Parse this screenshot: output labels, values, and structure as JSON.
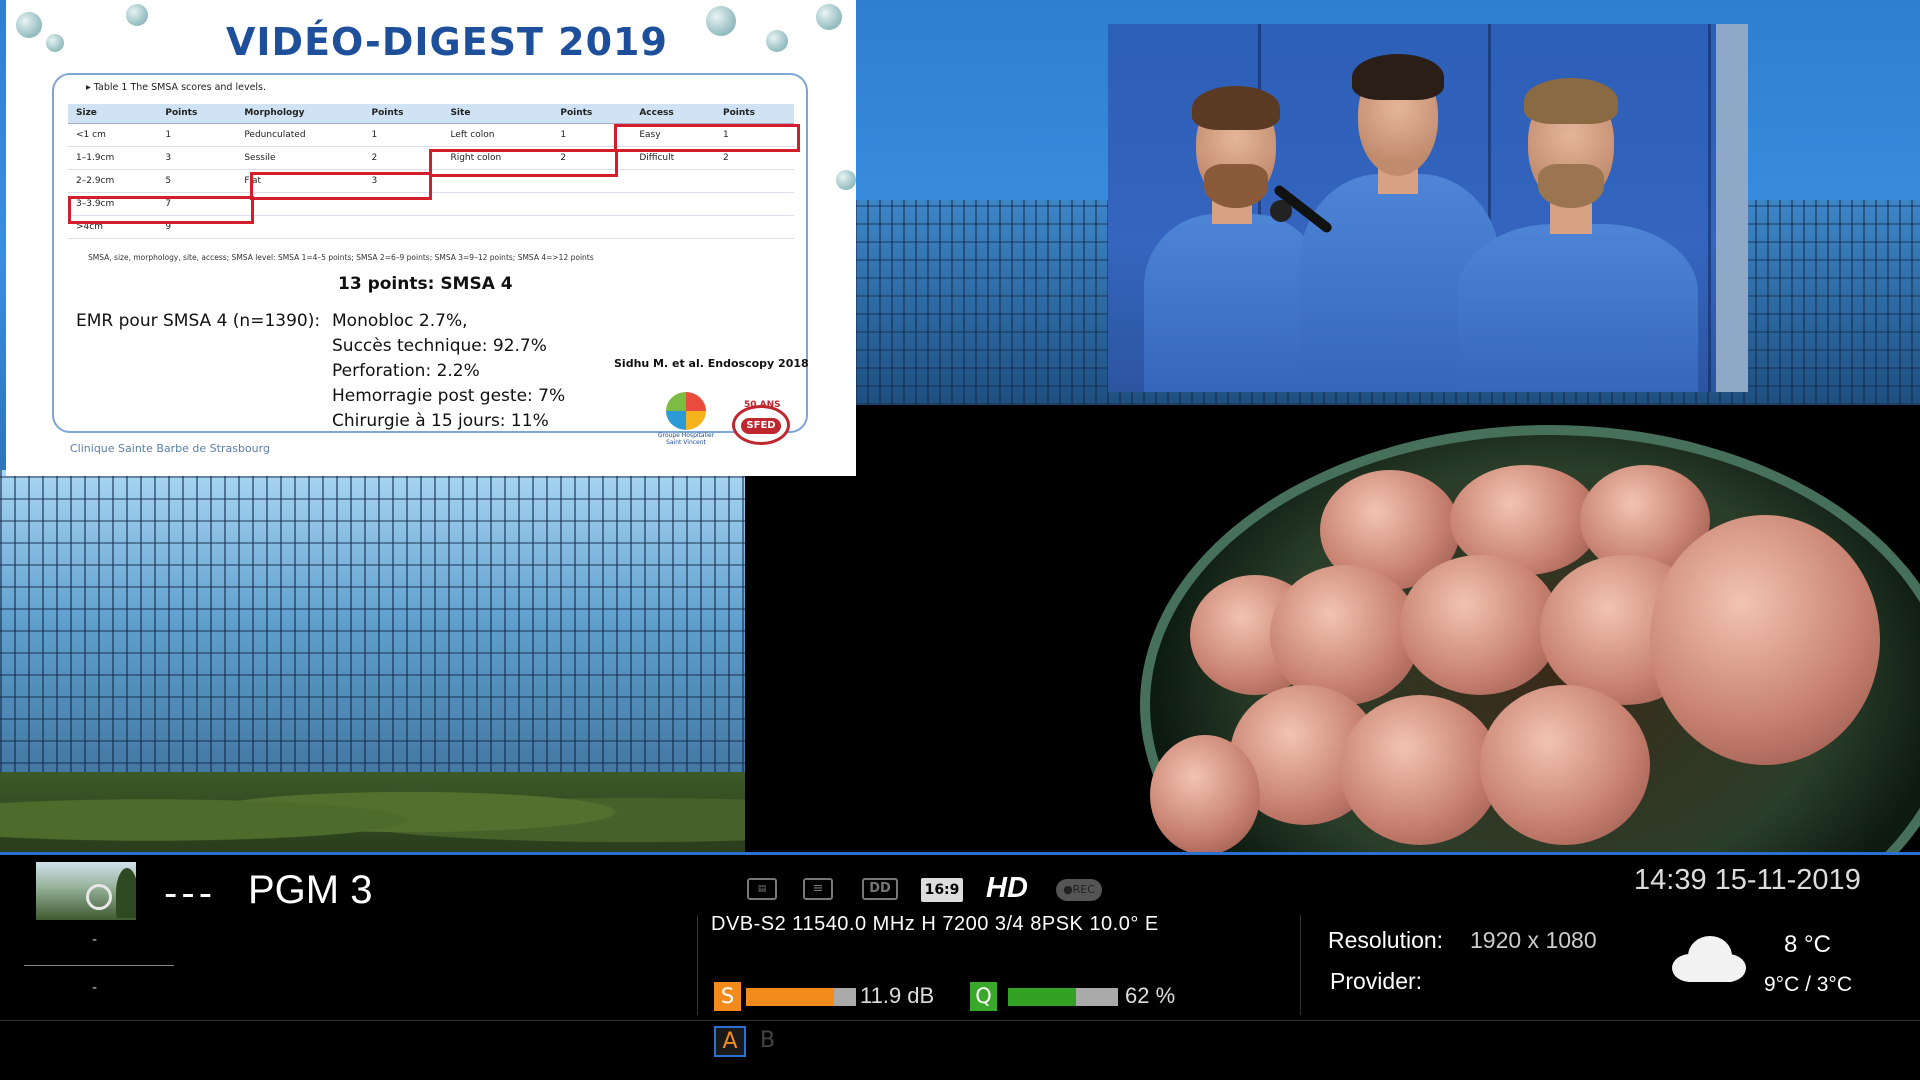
{
  "slide": {
    "title": "VIDÉO-DIGEST 2019",
    "table_caption": "▸ Table 1  The SMSA scores and levels.",
    "table_headers": [
      "Size",
      "Points",
      "Morphology",
      "Points",
      "Site",
      "Points",
      "Access",
      "Points"
    ],
    "table_rows": [
      [
        "<1 cm",
        "1",
        "Pedunculated",
        "1",
        "Left colon",
        "1",
        "Easy",
        "1"
      ],
      [
        "1–1.9cm",
        "3",
        "Sessile",
        "2",
        "Right colon",
        "2",
        "Difficult",
        "2"
      ],
      [
        "2–2.9cm",
        "5",
        "Flat",
        "3",
        "",
        "",
        "",
        ""
      ],
      [
        "3–3.9cm",
        "7",
        "",
        "",
        "",
        "",
        "",
        ""
      ],
      [
        ">4cm",
        "9",
        "",
        "",
        "",
        "",
        "",
        ""
      ]
    ],
    "table_note": "SMSA, size, morphology, site, access; SMSA level: SMSA 1=4–5 points; SMSA 2=6–9 points; SMSA 3=9–12 points; SMSA 4=>12 points",
    "points_line": "13 points: SMSA 4",
    "emr_label": "EMR pour SMSA 4 (n=1390):",
    "results": [
      "Monobloc 2.7%,",
      "Succès technique: 92.7%",
      "Perforation: 2.2%",
      "Hemorragie post geste: 7%",
      "Chirurgie à 15 jours: 11%"
    ],
    "citation": "Sidhu M. et al. Endoscopy 2018",
    "clinic": "Clinique Sainte Barbe de Strasbourg",
    "logo1_text": "Groupe Hospitalier Saint Vincent",
    "logo2_top": "50 ANS",
    "logo2_text": "SFED"
  },
  "infobar": {
    "channel_number": "---",
    "channel_name": "PGM 3",
    "now_event": "-",
    "next_event": "-",
    "icons": {
      "teletext": "≡",
      "dolby": "DD",
      "aspect": "16:9",
      "hd": "HD",
      "rec": "●REC"
    },
    "tuner_info": "DVB-S2  11540.0 MHz  H  7200  3/4  8PSK  10.0° E",
    "signal": {
      "s_label": "S",
      "s_value_text": "11.9 dB",
      "s_fraction": 0.8,
      "q_label": "Q",
      "q_value_text": "62 %",
      "q_fraction": 0.62,
      "s_color": "#f28a1c",
      "q_color": "#33a123"
    },
    "audio": {
      "a_label": "A",
      "b_label": "B"
    },
    "clock": "14:39 15-11-2019",
    "resolution_label": "Resolution:",
    "resolution_value": "1920 x 1080",
    "provider_label": "Provider:",
    "weather": {
      "icon": "cloud-icon",
      "temp": "8 °C",
      "range": "9°C / 3°C"
    },
    "accent_color": "#2b6fd0"
  }
}
